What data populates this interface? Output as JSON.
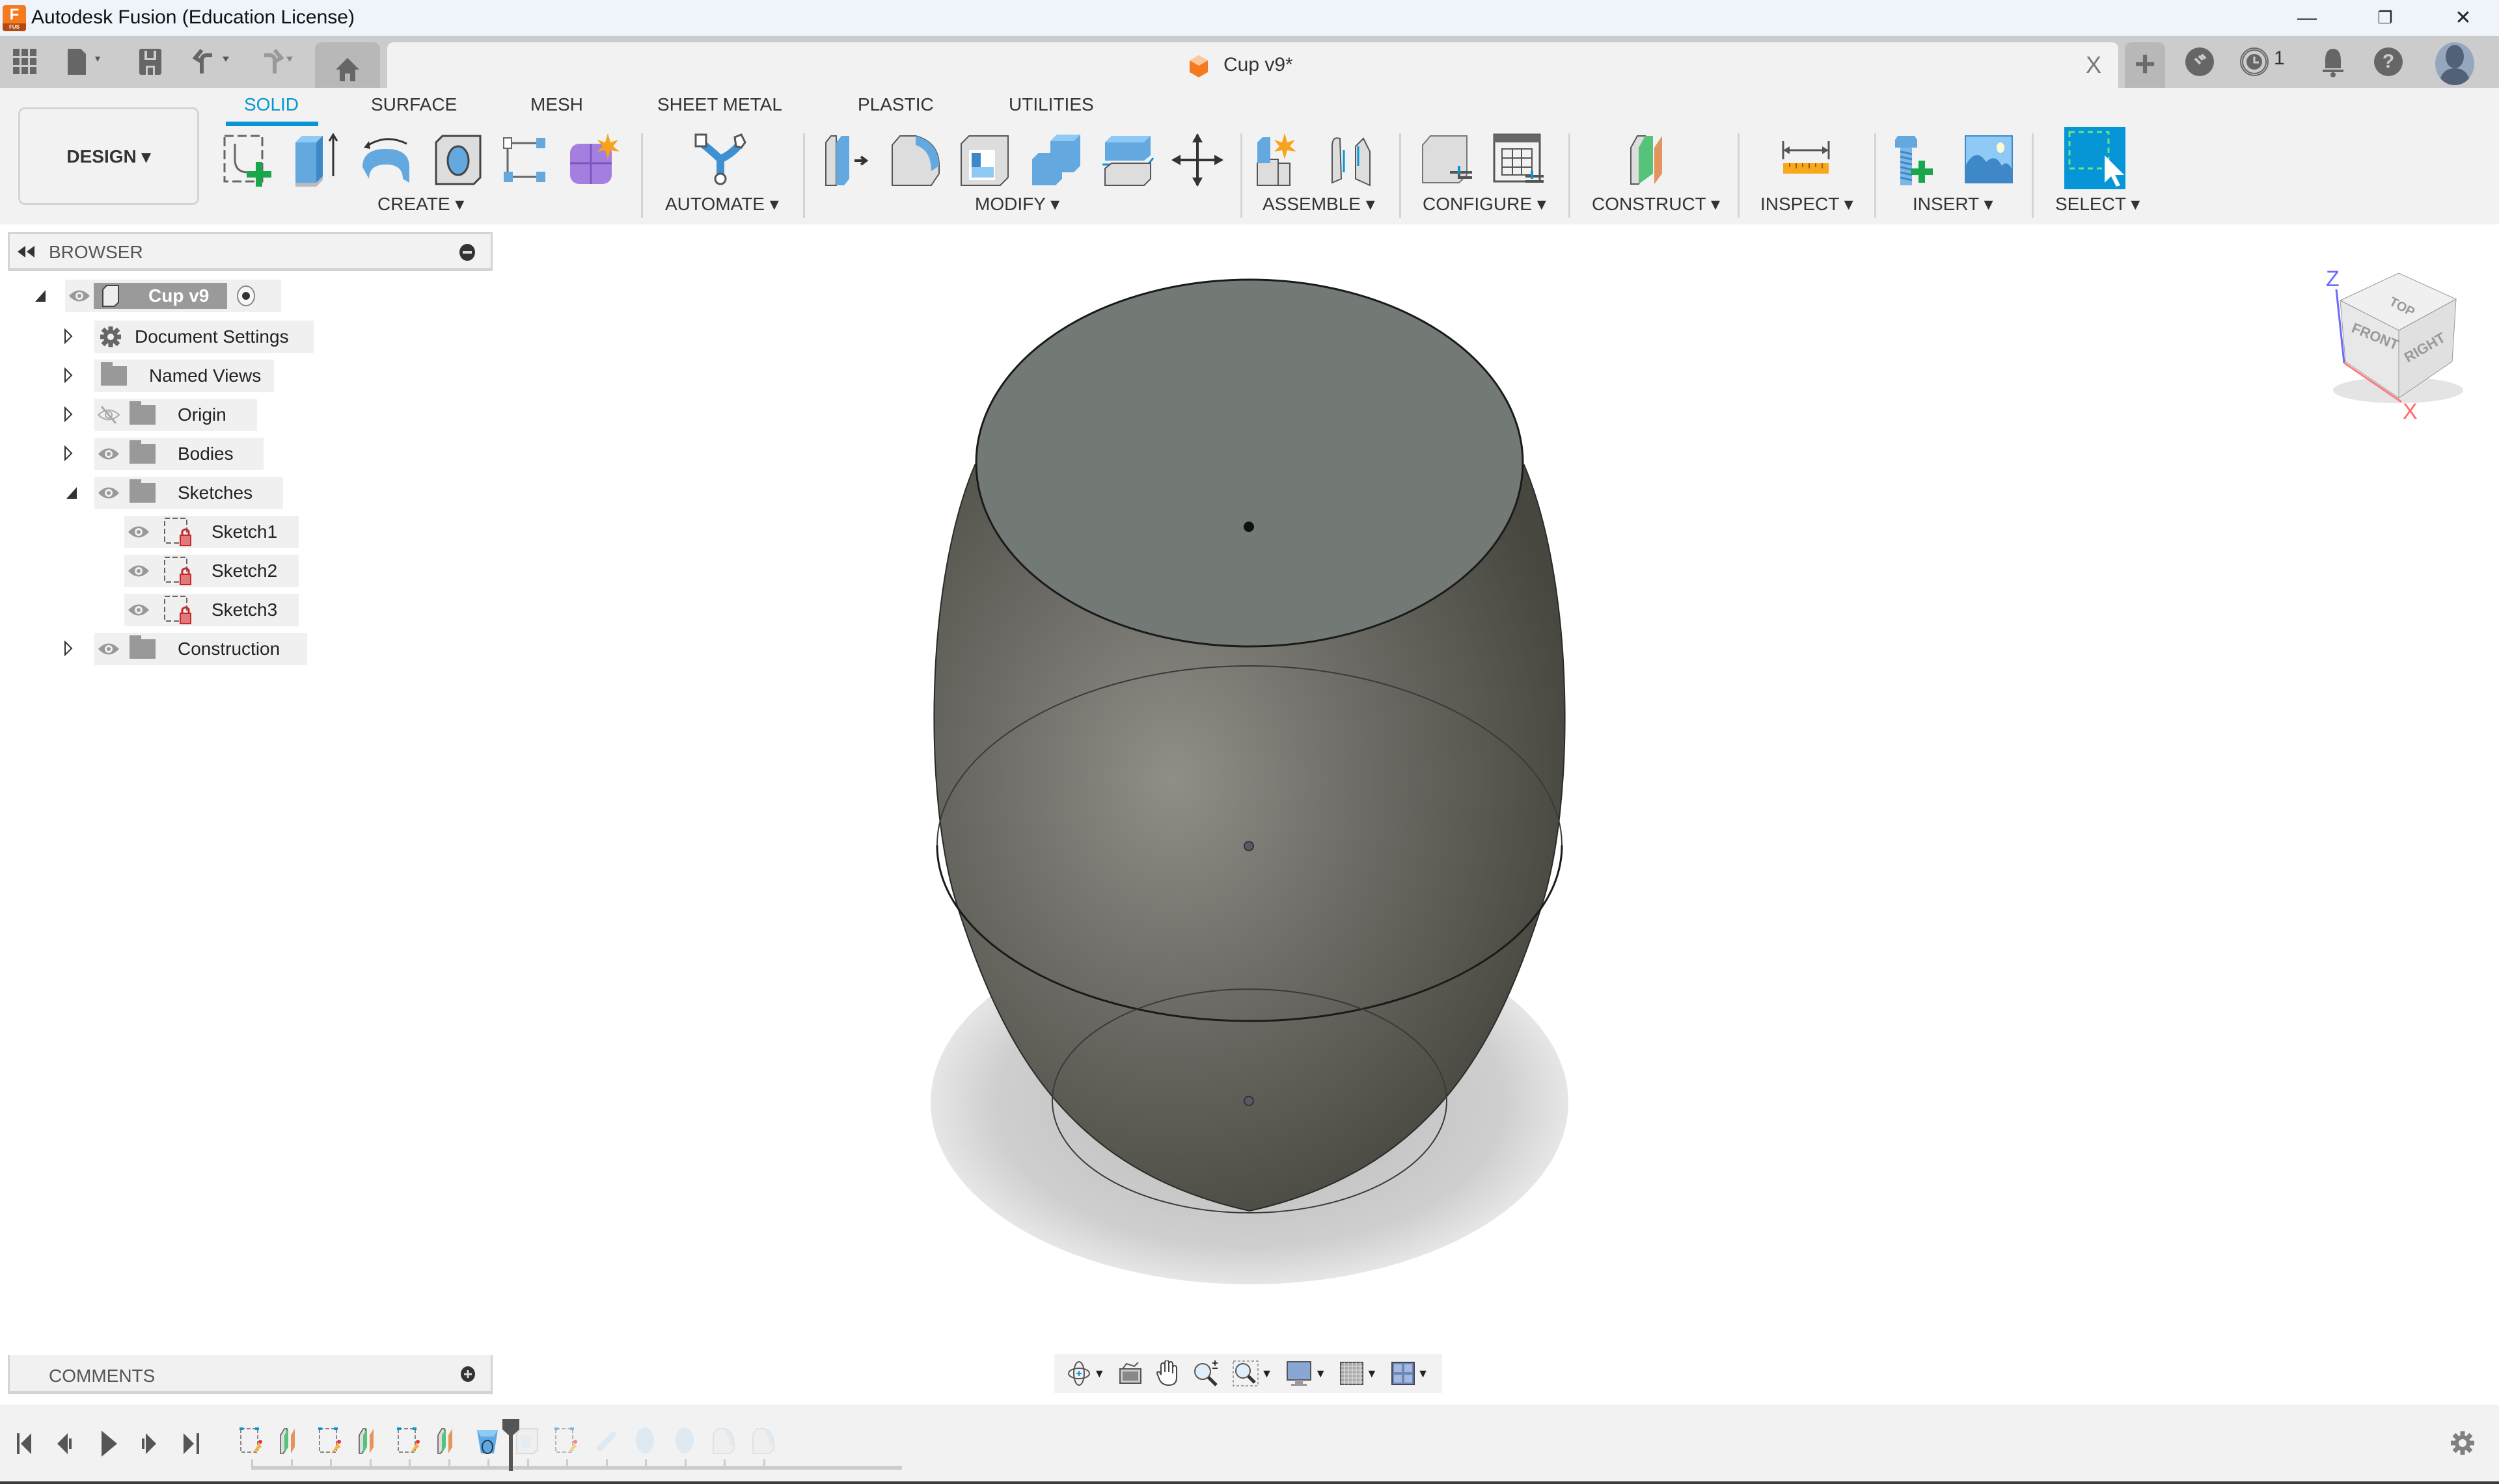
{
  "app": {
    "title": "Autodesk Fusion (Education License)",
    "logo_letter": "F",
    "logo_sub": "FUS",
    "window_controls": {
      "minimize": "—",
      "restore": "❐",
      "close": "✕"
    }
  },
  "quick_access": {
    "items": [
      {
        "name": "data-panel",
        "icon": "grid-icon"
      },
      {
        "name": "file-menu",
        "icon": "file-icon"
      },
      {
        "name": "save",
        "icon": "save-icon"
      },
      {
        "name": "undo",
        "icon": "undo-icon"
      },
      {
        "name": "redo",
        "icon": "redo-icon"
      },
      {
        "name": "home",
        "icon": "home-icon"
      }
    ]
  },
  "document_tab": {
    "label": "Cup v9*",
    "close": "X",
    "new_tab": "+"
  },
  "header_right": {
    "job_status_count": "1",
    "icons": [
      "extensions-icon",
      "job-status-icon",
      "notifications-icon",
      "help-icon",
      "user-avatar"
    ]
  },
  "toolbar": {
    "workspace_button": "DESIGN ▾",
    "tabs": [
      {
        "label": "SOLID",
        "active": true
      },
      {
        "label": "SURFACE",
        "active": false
      },
      {
        "label": "MESH",
        "active": false
      },
      {
        "label": "SHEET METAL",
        "active": false
      },
      {
        "label": "PLASTIC",
        "active": false
      },
      {
        "label": "UTILITIES",
        "active": false
      }
    ],
    "groups": [
      {
        "label": "CREATE ▾",
        "tools": [
          "create-sketch",
          "extrude",
          "revolve",
          "hole",
          "pattern",
          "create-form"
        ]
      },
      {
        "label": "AUTOMATE ▾",
        "tools": [
          "automated-modeling"
        ]
      },
      {
        "label": "MODIFY ▾",
        "tools": [
          "press-pull",
          "fillet",
          "shell",
          "combine",
          "split-body",
          "move-copy"
        ]
      },
      {
        "label": "ASSEMBLE ▾",
        "tools": [
          "new-component",
          "joint"
        ]
      },
      {
        "label": "CONFIGURE ▾",
        "tools": [
          "configure-model",
          "configuration-table"
        ]
      },
      {
        "label": "CONSTRUCT ▾",
        "tools": [
          "offset-plane"
        ]
      },
      {
        "label": "INSPECT ▾",
        "tools": [
          "measure"
        ]
      },
      {
        "label": "INSERT ▾",
        "tools": [
          "insert-mcmaster",
          "insert-canvas"
        ]
      },
      {
        "label": "SELECT ▾",
        "tools": [
          "window-select"
        ]
      }
    ]
  },
  "browser": {
    "title": "BROWSER",
    "root": {
      "label": "Cup v9",
      "expanded": true
    },
    "items": [
      {
        "label": "Document Settings",
        "icon": "gear-icon",
        "expanded": false,
        "visible": null,
        "level": 1
      },
      {
        "label": "Named Views",
        "icon": "folder-icon",
        "expanded": false,
        "visible": null,
        "level": 1
      },
      {
        "label": "Origin",
        "icon": "folder-icon",
        "expanded": false,
        "visible": false,
        "level": 1
      },
      {
        "label": "Bodies",
        "icon": "folder-icon",
        "expanded": false,
        "visible": true,
        "level": 1
      },
      {
        "label": "Sketches",
        "icon": "folder-icon",
        "expanded": true,
        "visible": true,
        "level": 1
      },
      {
        "label": "Sketch1",
        "icon": "sketch-locked-icon",
        "visible": true,
        "level": 2
      },
      {
        "label": "Sketch2",
        "icon": "sketch-locked-icon",
        "visible": true,
        "level": 2
      },
      {
        "label": "Sketch3",
        "icon": "sketch-locked-icon",
        "visible": true,
        "level": 2
      },
      {
        "label": "Construction",
        "icon": "folder-icon",
        "expanded": false,
        "visible": true,
        "level": 1
      }
    ]
  },
  "comments": {
    "title": "COMMENTS"
  },
  "viewcube": {
    "top": "TOP",
    "front": "FRONT",
    "right": "RIGHT",
    "axis_z": "Z",
    "axis_x": "X"
  },
  "navbar": {
    "items": [
      "orbit",
      "look-at",
      "pan",
      "zoom",
      "fit",
      "display-settings",
      "grid-snaps",
      "viewports"
    ]
  },
  "timeline": {
    "features": [
      "sketch",
      "plane",
      "sketch",
      "plane",
      "sketch",
      "plane",
      "loft",
      "shell",
      "sketch",
      "pipe",
      "ellipsoid",
      "ellipsoid",
      "fillet",
      "fillet"
    ],
    "marker_after": 7,
    "controls": [
      "first",
      "previous",
      "play",
      "next",
      "last"
    ]
  },
  "colors": {
    "accent": "#0696d7",
    "titlebar": "#eff3fa",
    "tabbar": "#cccccc",
    "panel": "#f2f2f2",
    "model_body": "#5f605a",
    "model_top": "#727a75"
  }
}
